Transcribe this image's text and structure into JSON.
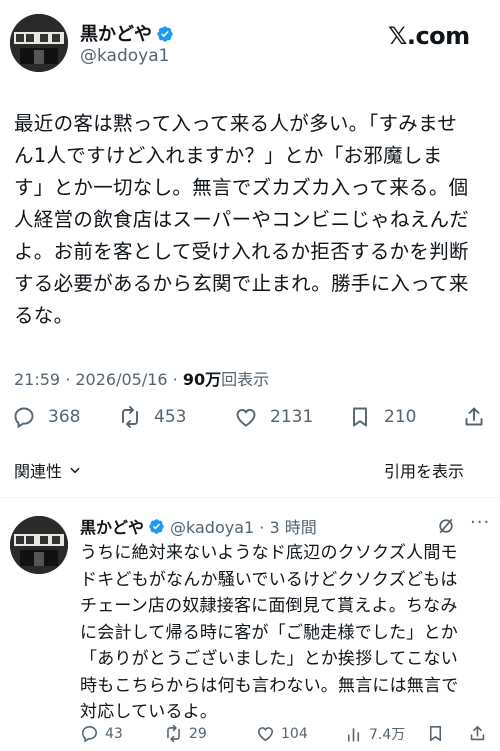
{
  "header": {
    "display_name": "黒かどや",
    "handle": "@kadoya1",
    "brand": "𝕏.com"
  },
  "tweet": {
    "text": "最近の客は黙って入って来る人が多い。「すみませ\nん1人ですけど入れますか？」とか「お邪魔しま\nす」とか一切なし。無言でズカズカ入って来る。個\n人経営の飲食店はスーパーやコンビニじゃねえんだ\nよ。お前を客として受け入れるか拒否するかを判断\nする必要があるから玄関で止まれ。勝手に入って来\nるな。",
    "time": "21:59 · 2026/05/16 · ",
    "views_number": "90万",
    "views_label": "回表示",
    "replies": "368",
    "reposts": "453",
    "likes": "2131",
    "bookmarks": "210"
  },
  "tabs": {
    "related": "関連性",
    "quotes": "引用を表示"
  },
  "reply": {
    "display_name": "黒かどや",
    "handle_time": "@kadoya1 · 3 時間",
    "text": "うちに絶対来ないようなド底辺のクソクズ人間モ\nドキどもがなんか騒いでいるけどクソクズどもは\nチェーン店の奴隷接客に面倒見て貰えよ。ちなみ\nに会計して帰る時に客が「ご馳走様でした」とか\n「ありがとうございました」とか挨拶してこない\n時もこちらからは何も言わない。無言には無言で\n対応しているよ。",
    "replies": "43",
    "reposts": "29",
    "likes": "104",
    "views": "7.4万"
  },
  "colors": {
    "verified": "#1d9bf0",
    "secondary_text": "#536471",
    "primary_text": "#0f1419"
  }
}
